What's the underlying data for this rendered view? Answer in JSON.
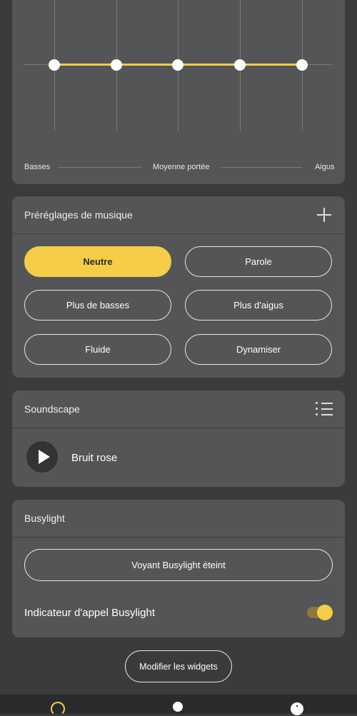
{
  "equalizer": {
    "labels": {
      "low": "Basses",
      "mid": "Moyenne portée",
      "high": "Aigus"
    },
    "bands": 5
  },
  "presets": {
    "title": "Préréglages de musique",
    "items": [
      {
        "label": "Neutre",
        "active": true
      },
      {
        "label": "Parole",
        "active": false
      },
      {
        "label": "Plus de basses",
        "active": false
      },
      {
        "label": "Plus d'aigus",
        "active": false
      },
      {
        "label": "Fluide",
        "active": false
      },
      {
        "label": "Dynamiser",
        "active": false
      }
    ]
  },
  "soundscape": {
    "title": "Soundscape",
    "track": "Bruit rose"
  },
  "busylight": {
    "title": "Busylight",
    "status_button": "Voyant Busylight éteint",
    "call_indicator_label": "Indicateur d'appel Busylight",
    "call_indicator_on": true
  },
  "footer": {
    "edit_widgets": "Modifier les widgets"
  },
  "colors": {
    "accent": "#f5cd47",
    "card": "#545557",
    "background": "#3a3b3d"
  },
  "icons": {
    "add": "plus-icon",
    "list": "list-icon",
    "play": "play-icon",
    "nav": [
      "headphones-icon",
      "bulb-icon",
      "info-icon"
    ]
  }
}
